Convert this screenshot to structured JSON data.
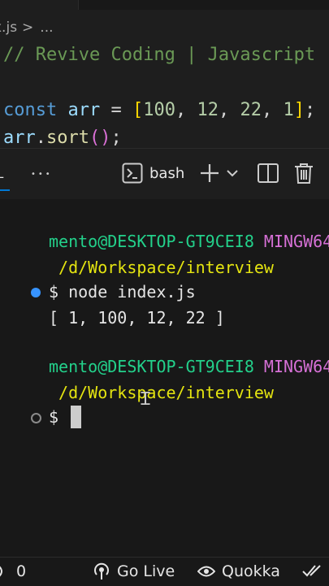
{
  "breadcrumb": {
    "file": "x.js",
    "separator": ">",
    "more": "..."
  },
  "editor": {
    "comment": "// Revive Coding | Javascript",
    "line2": {
      "kw": "const",
      "var": "arr",
      "op": " = ",
      "open": "[",
      "n1": "100",
      "n2": "12",
      "n3": "22",
      "n4": "1",
      "close": "]",
      "semi": ";"
    },
    "line3": {
      "var": "arr",
      "dot": ".",
      "fn": "sort",
      "parens": "()",
      "semi": ";"
    }
  },
  "panel": {
    "tab_stub": "L",
    "more": "•••",
    "terminal_name": "bash"
  },
  "terminal": {
    "prompt1": {
      "user": "mento@DESKTOP-GT9CEI8",
      "env": "MINGW64",
      "path": " /d/Workspace/interview"
    },
    "command": "$ node index.js",
    "output": "[ 1, 100, 12, 22 ]",
    "prompt2": {
      "user": "mento@DESKTOP-GT9CEI8",
      "env": "MINGW64",
      "path": " /d/Workspace/interview"
    },
    "prompt_symbol": "$"
  },
  "statusbar": {
    "ports": "0",
    "go_live": "Go Live",
    "quokka": "Quokka"
  }
}
